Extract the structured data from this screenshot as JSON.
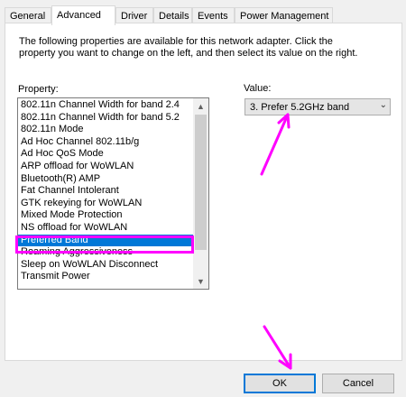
{
  "tabs": [
    {
      "label": "General"
    },
    {
      "label": "Advanced"
    },
    {
      "label": "Driver"
    },
    {
      "label": "Details"
    },
    {
      "label": "Events"
    },
    {
      "label": "Power Management"
    }
  ],
  "description": "The following properties are available for this network adapter. Click the property you want to change on the left, and then select its value on the right.",
  "property_label": "Property:",
  "value_label": "Value:",
  "properties": [
    "802.11n Channel Width for band 2.4",
    "802.11n Channel Width for band 5.2",
    "802.11n Mode",
    "Ad Hoc Channel 802.11b/g",
    "Ad Hoc QoS Mode",
    "ARP offload for WoWLAN",
    "Bluetooth(R) AMP",
    "Fat Channel Intolerant",
    "GTK rekeying for WoWLAN",
    "Mixed Mode Protection",
    "NS offload for WoWLAN",
    "Preferred Band",
    "Roaming Aggressiveness",
    "Sleep on WoWLAN Disconnect",
    "Transmit Power"
  ],
  "selected_property": "Preferred Band",
  "value_selected": "3. Prefer 5.2GHz band",
  "buttons": {
    "ok": "OK",
    "cancel": "Cancel"
  },
  "colors": {
    "selection": "#0078d7",
    "annotation": "#ff00ff"
  }
}
